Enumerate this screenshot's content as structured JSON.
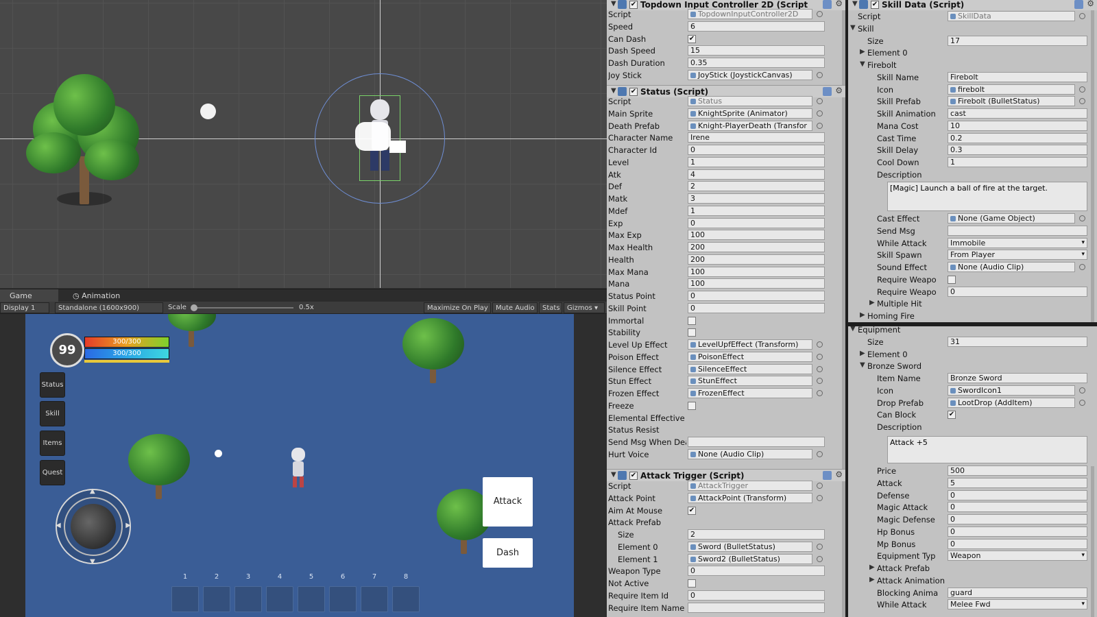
{
  "colors": {
    "scene_bg": "#484848",
    "game_bg": "#3a5d96",
    "inspector_bg": "#c2c2c2",
    "health": "#e53b2a",
    "mana": "#2aa6e5"
  },
  "game_tabs": {
    "game": "Game",
    "animation": "Animation"
  },
  "game_toolbar": {
    "display": "Display 1",
    "resolution": "Standalone (1600x900)",
    "scale_label": "Scale",
    "scale_value": "0.5x",
    "maximize": "Maximize On Play",
    "mute": "Mute Audio",
    "stats": "Stats",
    "gizmos": "Gizmos"
  },
  "hud": {
    "level": "99",
    "hp": "300/300",
    "mp": "300/300",
    "hp_fraction": 1.0,
    "mp_fraction": 1.0,
    "buttons": {
      "status": "Status",
      "skill": "Skill",
      "items": "Items",
      "quest": "Quest"
    },
    "attack": "Attack",
    "dash": "Dash",
    "slots": [
      "1",
      "2",
      "3",
      "4",
      "5",
      "6",
      "7",
      "8"
    ]
  },
  "topdown": {
    "title": "Topdown Input Controller 2D (Script",
    "rows": [
      {
        "label": "Script",
        "value": "TopdownInputController2D",
        "kind": "gray"
      },
      {
        "label": "Speed",
        "value": "6",
        "kind": "text"
      },
      {
        "label": "Can Dash",
        "value": "✔",
        "kind": "check"
      },
      {
        "label": "Dash Speed",
        "value": "15",
        "kind": "text"
      },
      {
        "label": "Dash Duration",
        "value": "0.35",
        "kind": "text"
      },
      {
        "label": "Joy Stick",
        "value": "JoyStick (JoystickCanvas)",
        "kind": "obj"
      }
    ]
  },
  "status": {
    "title": "Status (Script)",
    "rows": [
      {
        "label": "Script",
        "value": "Status",
        "kind": "gray"
      },
      {
        "label": "Main Sprite",
        "value": "KnightSprite (Animator)",
        "kind": "obj"
      },
      {
        "label": "Death Prefab",
        "value": "Knight-PlayerDeath (Transfor",
        "kind": "obj"
      },
      {
        "label": "Character Name",
        "value": "Irene",
        "kind": "text"
      },
      {
        "label": "Character Id",
        "value": "0",
        "kind": "text"
      },
      {
        "label": "Level",
        "value": "1",
        "kind": "text"
      },
      {
        "label": "Atk",
        "value": "4",
        "kind": "text"
      },
      {
        "label": "Def",
        "value": "2",
        "kind": "text"
      },
      {
        "label": "Matk",
        "value": "3",
        "kind": "text"
      },
      {
        "label": "Mdef",
        "value": "1",
        "kind": "text"
      },
      {
        "label": "Exp",
        "value": "0",
        "kind": "text"
      },
      {
        "label": "Max Exp",
        "value": "100",
        "kind": "text"
      },
      {
        "label": "Max Health",
        "value": "200",
        "kind": "text"
      },
      {
        "label": "Health",
        "value": "200",
        "kind": "text"
      },
      {
        "label": "Max Mana",
        "value": "100",
        "kind": "text"
      },
      {
        "label": "Mana",
        "value": "100",
        "kind": "text"
      },
      {
        "label": "Status Point",
        "value": "0",
        "kind": "text"
      },
      {
        "label": "Skill Point",
        "value": "0",
        "kind": "text"
      },
      {
        "label": "Immortal",
        "value": "",
        "kind": "check"
      },
      {
        "label": "Stability",
        "value": "",
        "kind": "check"
      },
      {
        "label": "Level Up Effect",
        "value": "LevelUpfEffect (Transform)",
        "kind": "obj"
      },
      {
        "label": "Poison Effect",
        "value": "PoisonEffect",
        "kind": "obj"
      },
      {
        "label": "Silence Effect",
        "value": "SilenceEffect",
        "kind": "obj"
      },
      {
        "label": "Stun Effect",
        "value": "StunEffect",
        "kind": "obj"
      },
      {
        "label": "Frozen Effect",
        "value": "FrozenEffect",
        "kind": "obj"
      },
      {
        "label": "Freeze",
        "value": "",
        "kind": "check"
      },
      {
        "label": "Elemental Effective",
        "value": "",
        "kind": "fold"
      },
      {
        "label": "Status Resist",
        "value": "",
        "kind": "fold"
      },
      {
        "label": "Send Msg When Dea",
        "value": "",
        "kind": "text"
      },
      {
        "label": "Hurt Voice",
        "value": "None (Audio Clip)",
        "kind": "obj"
      }
    ]
  },
  "attack_trigger": {
    "title": "Attack Trigger (Script)",
    "rows": [
      {
        "label": "Script",
        "value": "AttackTrigger",
        "kind": "gray"
      },
      {
        "label": "Attack Point",
        "value": "AttackPoint (Transform)",
        "kind": "obj"
      },
      {
        "label": "Aim At Mouse",
        "value": "✔",
        "kind": "check"
      },
      {
        "label": "Attack Prefab",
        "value": "",
        "kind": "open"
      },
      {
        "label": "Size",
        "value": "2",
        "kind": "text",
        "indent": 1
      },
      {
        "label": "Element 0",
        "value": "Sword (BulletStatus)",
        "kind": "obj",
        "indent": 1
      },
      {
        "label": "Element 1",
        "value": "Sword2 (BulletStatus)",
        "kind": "obj",
        "indent": 1
      },
      {
        "label": "Weapon Type",
        "value": "0",
        "kind": "text"
      },
      {
        "label": "Not Active",
        "value": "",
        "kind": "check"
      },
      {
        "label": "Require Item Id",
        "value": "0",
        "kind": "text"
      },
      {
        "label": "Require Item Name",
        "value": "",
        "kind": "text"
      }
    ]
  },
  "skill_data": {
    "title": "Skill Data (Script)",
    "rows": [
      {
        "label": "Script",
        "value": "SkillData",
        "kind": "gray"
      },
      {
        "label": "Skill",
        "value": "",
        "kind": "open",
        "indent": 0
      },
      {
        "label": "Size",
        "value": "17",
        "kind": "text",
        "indent": 1
      },
      {
        "label": "Element 0",
        "value": "",
        "kind": "fold",
        "indent": 1
      },
      {
        "label": "Firebolt",
        "value": "",
        "kind": "open",
        "indent": 1
      },
      {
        "label": "Skill Name",
        "value": "Firebolt",
        "kind": "text",
        "indent": 2
      },
      {
        "label": "Icon",
        "value": "firebolt",
        "kind": "obj",
        "indent": 2
      },
      {
        "label": "Skill Prefab",
        "value": "Firebolt (BulletStatus)",
        "kind": "obj",
        "indent": 2
      },
      {
        "label": "Skill Animation",
        "value": "cast",
        "kind": "text",
        "indent": 2
      },
      {
        "label": "Mana Cost",
        "value": "10",
        "kind": "text",
        "indent": 2
      },
      {
        "label": "Cast Time",
        "value": "0.2",
        "kind": "text",
        "indent": 2
      },
      {
        "label": "Skill Delay",
        "value": "0.3",
        "kind": "text",
        "indent": 2
      },
      {
        "label": "Cool Down",
        "value": "1",
        "kind": "text",
        "indent": 2
      },
      {
        "label": "Description",
        "value": "",
        "kind": "label",
        "indent": 2
      }
    ],
    "description": "[Magic] Launch a ball of fire at the target.",
    "rows2": [
      {
        "label": "Cast Effect",
        "value": "None (Game Object)",
        "kind": "obj",
        "indent": 2
      },
      {
        "label": "Send Msg",
        "value": "",
        "kind": "text",
        "indent": 2
      },
      {
        "label": "While Attack",
        "value": "Immobile",
        "kind": "select",
        "indent": 2
      },
      {
        "label": "Skill Spawn",
        "value": "From Player",
        "kind": "select",
        "indent": 2
      },
      {
        "label": "Sound Effect",
        "value": "None (Audio Clip)",
        "kind": "obj",
        "indent": 2
      },
      {
        "label": "Require Weapo",
        "value": "",
        "kind": "check",
        "indent": 2
      },
      {
        "label": "Require Weapo",
        "value": "0",
        "kind": "text",
        "indent": 2
      },
      {
        "label": "Multiple Hit",
        "value": "",
        "kind": "fold",
        "indent": 2
      },
      {
        "label": "Homing Fire",
        "value": "",
        "kind": "fold",
        "indent": 1
      }
    ]
  },
  "equipment": {
    "rows": [
      {
        "label": "Equipment",
        "value": "",
        "kind": "open",
        "indent": 0
      },
      {
        "label": "Size",
        "value": "31",
        "kind": "text",
        "indent": 1
      },
      {
        "label": "Element 0",
        "value": "",
        "kind": "fold",
        "indent": 1
      },
      {
        "label": "Bronze Sword",
        "value": "",
        "kind": "open",
        "indent": 1
      },
      {
        "label": "Item Name",
        "value": "Bronze Sword",
        "kind": "text",
        "indent": 2
      },
      {
        "label": "Icon",
        "value": "SwordIcon1",
        "kind": "obj",
        "indent": 2
      },
      {
        "label": "Drop Prefab",
        "value": "LootDrop (AddItem)",
        "kind": "obj",
        "indent": 2
      },
      {
        "label": "Can Block",
        "value": "✔",
        "kind": "check",
        "indent": 2
      },
      {
        "label": "Description",
        "value": "",
        "kind": "label",
        "indent": 2
      }
    ],
    "description": "Attack +5",
    "rows2": [
      {
        "label": "Price",
        "value": "500",
        "kind": "text",
        "indent": 2
      },
      {
        "label": "Attack",
        "value": "5",
        "kind": "text",
        "indent": 2
      },
      {
        "label": "Defense",
        "value": "0",
        "kind": "text",
        "indent": 2
      },
      {
        "label": "Magic Attack",
        "value": "0",
        "kind": "text",
        "indent": 2
      },
      {
        "label": "Magic Defense",
        "value": "0",
        "kind": "text",
        "indent": 2
      },
      {
        "label": "Hp Bonus",
        "value": "0",
        "kind": "text",
        "indent": 2
      },
      {
        "label": "Mp Bonus",
        "value": "0",
        "kind": "text",
        "indent": 2
      },
      {
        "label": "Equipment Typ",
        "value": "Weapon",
        "kind": "select",
        "indent": 2
      },
      {
        "label": "Attack Prefab",
        "value": "",
        "kind": "fold",
        "indent": 2
      },
      {
        "label": "Attack Animation Trigger",
        "value": "",
        "kind": "fold",
        "indent": 2
      },
      {
        "label": "Blocking Anima",
        "value": "guard",
        "kind": "text",
        "indent": 2
      },
      {
        "label": "While Attack",
        "value": "Melee Fwd",
        "kind": "select",
        "indent": 2
      }
    ]
  }
}
